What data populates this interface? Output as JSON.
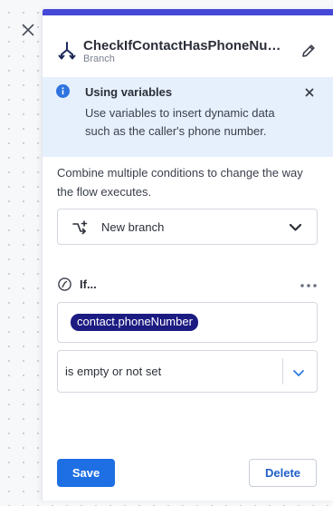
{
  "panel": {
    "title": "CheckIfContactHasPhoneNumber",
    "subtitle": "Branch"
  },
  "info": {
    "title": "Using variables",
    "text": "Use variables to insert dynamic data such as the caller's phone number."
  },
  "description": "Combine multiple conditions to change the way the flow executes.",
  "branch_select": {
    "label": "New branch"
  },
  "condition": {
    "label": "If...",
    "variable": "contact.phoneNumber",
    "operator": "is empty or not set"
  },
  "buttons": {
    "save": "Save",
    "delete": "Delete"
  },
  "colors": {
    "accent": "#4548d7",
    "primary_button": "#1d6fe3",
    "variable_chip": "#1c1b82",
    "info_bg": "#e6f0fd"
  },
  "icons": {
    "close": "close-icon",
    "branch": "branch-icon",
    "edit": "pencil-icon",
    "info": "info-icon",
    "dismiss": "close-icon",
    "new_branch": "split-arrow-icon",
    "chevron": "chevron-down-icon",
    "condition": "condition-icon",
    "more": "more-horizontal-icon"
  }
}
